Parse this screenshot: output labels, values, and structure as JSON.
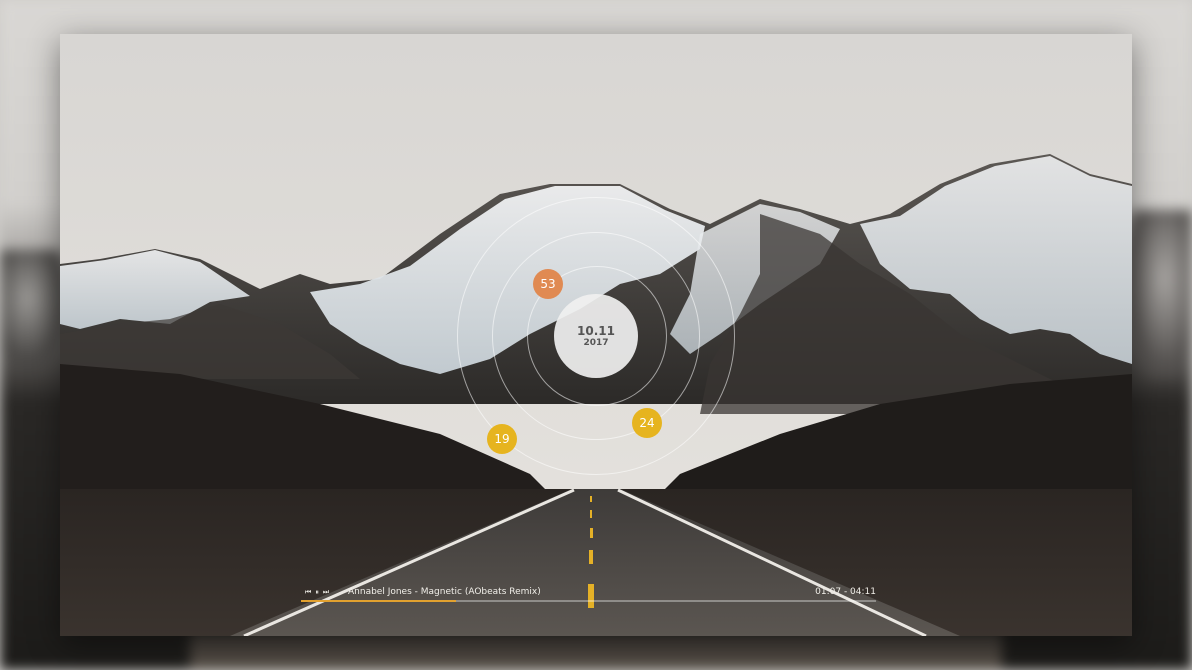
{
  "clock": {
    "date": "10.11",
    "year": "2017",
    "hours": {
      "value": "53",
      "color": "#e08a52"
    },
    "seconds": {
      "value": "24",
      "color": "#e6b41f"
    },
    "minutes": {
      "value": "19",
      "color": "#e6b41f"
    }
  },
  "player": {
    "prev_icon": "⏮",
    "pause_icon": "⏸",
    "next_icon": "⏭",
    "track": "Annabel Jones - Magnetic (AObeats Remix)",
    "time": "01:07 - 04:11",
    "progress": 0.27,
    "accent": "#e2a12f"
  }
}
